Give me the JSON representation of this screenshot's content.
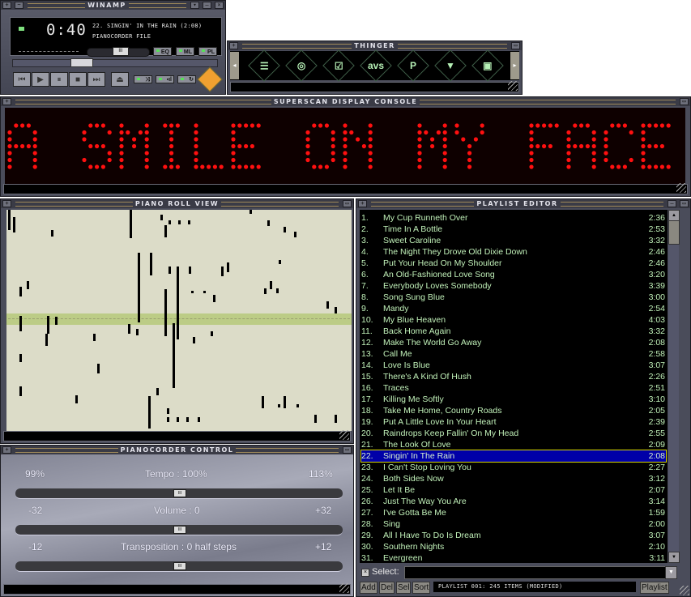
{
  "main": {
    "title": "WINAMP",
    "time": "0:40",
    "song_title": "22. SINGIN' IN THE RAIN (2:08)",
    "song_subtitle": "PIANOCORDER FILE",
    "toggles": [
      "EQ",
      "ML",
      "PL"
    ],
    "transport": {
      "prev": "⏮",
      "play": "▶",
      "pause": "⏸",
      "stop": "■",
      "next": "⏭",
      "eject": "⏏"
    },
    "mode_toggles": [
      "shuffle",
      "eq-bars",
      "repeat"
    ],
    "volume_fraction": 0.55,
    "seek_fraction": 0.32
  },
  "thinger": {
    "title": "THINGER",
    "icons": [
      {
        "name": "playlist-icon",
        "glyph": "☰"
      },
      {
        "name": "cd-icon",
        "glyph": "◎"
      },
      {
        "name": "options-icon",
        "glyph": "☑"
      },
      {
        "name": "avs-icon",
        "glyph": "avs"
      },
      {
        "name": "p-icon",
        "glyph": "P"
      },
      {
        "name": "shield-icon",
        "glyph": "▼"
      },
      {
        "name": "dotted-square-icon",
        "glyph": "▣"
      }
    ]
  },
  "superscan": {
    "title": "SUPERSCAN DISPLAY CONSOLE",
    "scroll_text": "A SMILE ON MY FACE",
    "led_color": "#ff1010"
  },
  "pianoroll": {
    "title": "PIANO ROLL VIEW"
  },
  "control": {
    "title": "PIANOCORDER CONTROL",
    "sliders": [
      {
        "min_label": "99%",
        "label": "Tempo : 100%",
        "max_label": "113%",
        "value_fraction": 0.5
      },
      {
        "min_label": "-32",
        "label": "Volume : 0",
        "max_label": "+32",
        "value_fraction": 0.5
      },
      {
        "min_label": "-12",
        "label": "Transposition : 0 half steps",
        "max_label": "+12",
        "value_fraction": 0.5
      }
    ]
  },
  "playlist": {
    "title": "PLAYLIST EDITOR",
    "selected_index": 21,
    "items": [
      {
        "num": "1.",
        "title": "My Cup Runneth Over",
        "time": "2:36"
      },
      {
        "num": "2.",
        "title": "Time In A Bottle",
        "time": "2:53"
      },
      {
        "num": "3.",
        "title": "Sweet Caroline",
        "time": "3:32"
      },
      {
        "num": "4.",
        "title": "The Night They Drove Old Dixie Down",
        "time": "2:46"
      },
      {
        "num": "5.",
        "title": "Put Your Head On My Shoulder",
        "time": "2:46"
      },
      {
        "num": "6.",
        "title": "An Old-Fashioned Love Song",
        "time": "3:20"
      },
      {
        "num": "7.",
        "title": "Everybody Loves Somebody",
        "time": "3:39"
      },
      {
        "num": "8.",
        "title": "Song Sung Blue",
        "time": "3:00"
      },
      {
        "num": "9.",
        "title": "Mandy",
        "time": "2:54"
      },
      {
        "num": "10.",
        "title": "My Blue Heaven",
        "time": "4:03"
      },
      {
        "num": "11.",
        "title": "Back Home Again",
        "time": "3:32"
      },
      {
        "num": "12.",
        "title": "Make The World Go Away",
        "time": "2:08"
      },
      {
        "num": "13.",
        "title": "Call Me",
        "time": "2:58"
      },
      {
        "num": "14.",
        "title": "Love Is Blue",
        "time": "3:07"
      },
      {
        "num": "15.",
        "title": "There's A Kind Of Hush",
        "time": "2:26"
      },
      {
        "num": "16.",
        "title": "Traces",
        "time": "2:51"
      },
      {
        "num": "17.",
        "title": "Killing Me Softly",
        "time": "3:10"
      },
      {
        "num": "18.",
        "title": "Take Me Home, Country Roads",
        "time": "2:05"
      },
      {
        "num": "19.",
        "title": "Put A Little Love In Your Heart",
        "time": "2:39"
      },
      {
        "num": "20.",
        "title": "Raindrops Keep Fallin' On My Head",
        "time": "2:55"
      },
      {
        "num": "21.",
        "title": "The Look Of Love",
        "time": "2:09"
      },
      {
        "num": "22.",
        "title": "Singin' In The Rain",
        "time": "2:08"
      },
      {
        "num": "23.",
        "title": "I Can't Stop Loving You",
        "time": "2:27"
      },
      {
        "num": "24.",
        "title": "Both Sides Now",
        "time": "3:12"
      },
      {
        "num": "25.",
        "title": "Let It Be",
        "time": "2:07"
      },
      {
        "num": "26.",
        "title": "Just The Way You Are",
        "time": "3:14"
      },
      {
        "num": "27.",
        "title": "I've Gotta Be Me",
        "time": "1:59"
      },
      {
        "num": "28.",
        "title": "Sing",
        "time": "2:00"
      },
      {
        "num": "29.",
        "title": "All I Have To Do Is Dream",
        "time": "3:07"
      },
      {
        "num": "30.",
        "title": "Southern Nights",
        "time": "2:10"
      },
      {
        "num": "31.",
        "title": "Evergreen",
        "time": "3:11"
      }
    ],
    "select_label": "Select:",
    "select_value": "",
    "buttons": [
      "Add",
      "Del",
      "Sel",
      "Sort"
    ],
    "info": "PLAYLIST 001: 245 ITEMS (MODIFIED)",
    "playlist_button": "Playlist",
    "scroll_fraction": 0.0
  }
}
